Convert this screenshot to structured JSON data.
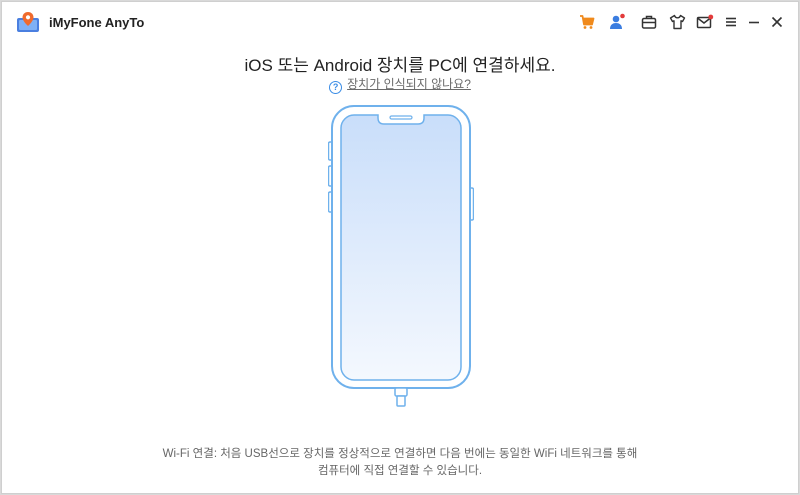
{
  "app": {
    "title": "iMyFone AnyTo"
  },
  "toolbar": {
    "icons": [
      "cart-icon",
      "user-icon",
      "toolbox-icon",
      "tshirt-icon",
      "mail-icon",
      "menu-icon",
      "minimize-icon",
      "close-icon"
    ],
    "accent": "#f08a1c",
    "notify": "#e33b3b"
  },
  "main": {
    "headline": "iOS 또는 Android 장치를 PC에 연결하세요.",
    "help_link": "장치가 인식되지 않나요?",
    "footer_line1": "Wi-Fi 연결: 처음 USB선으로 장치를 정상적으로 연결하면 다음 번에는 동일한 WiFi 네트워크를 통해",
    "footer_line2": "컴퓨터에 직접 연결할 수 있습니다."
  },
  "colors": {
    "phone_outline": "#6fb1ec",
    "screen_top": "#c9defa",
    "screen_bottom": "#f4f8fe"
  }
}
